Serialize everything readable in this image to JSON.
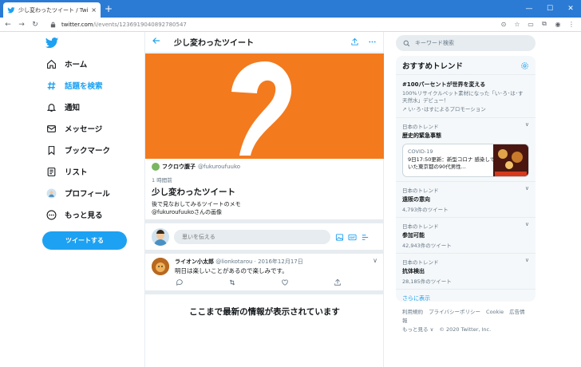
{
  "browser": {
    "tab_title": "少し変わったツイート / Twitter",
    "tab_close": "×",
    "new_tab": "+",
    "url_host": "twitter.com",
    "url_path": "/i/events/1236919040892780547",
    "window_buttons": [
      "—",
      "☐",
      "✕"
    ]
  },
  "nav": {
    "items": [
      {
        "label": "ホーム",
        "icon": "home-icon"
      },
      {
        "label": "話題を検索",
        "icon": "hashtag-icon",
        "active": true
      },
      {
        "label": "通知",
        "icon": "bell-icon"
      },
      {
        "label": "メッセージ",
        "icon": "mail-icon"
      },
      {
        "label": "ブックマーク",
        "icon": "bookmark-icon"
      },
      {
        "label": "リスト",
        "icon": "list-icon"
      },
      {
        "label": "プロフィール",
        "icon": "profile-avatar"
      },
      {
        "label": "もっと見る",
        "icon": "more-icon"
      }
    ],
    "tweet_button": "ツイートする"
  },
  "center": {
    "header_title": "少し変わったツイート",
    "owner_name": "フクロウ腹子",
    "owner_handle": "@fukuroufuuko",
    "time": "1 時間前",
    "title": "少し変わったツイート",
    "description_line1": "後で見なおしてみるツイートのメモ",
    "description_line2": "@fukuroufuukoさんの画像",
    "compose_placeholder": "思いを伝える",
    "tweet": {
      "name": "ライオン小太郎",
      "handle": "@lionkotarou",
      "date": "· 2016年12月17日",
      "text": "明日は楽しいことがあるので楽しみです。"
    },
    "end_message": "ここまで最新の情報が表示されています"
  },
  "right": {
    "search_placeholder": "キーワード検索",
    "trends_title": "おすすめトレンド",
    "promo": {
      "title": "#100パーセントが世界を変える",
      "desc": "100%リサイクルペット素材になった「い･ろ･は･す 天然水」デビュー！",
      "promoted": "い･ろ･はすによるプロモーション"
    },
    "trend1": {
      "category": "日本のトレンド",
      "name": "歴史的緊急事態",
      "news_label": "COVID-19",
      "news_text": "9日17:50更新：新型コロナ 感染していた東京都の90代男性..."
    },
    "trend2": {
      "category": "日本のトレンド",
      "name": "遠阪の意向",
      "count": "4,793件のツイート"
    },
    "trend3": {
      "category": "日本のトレンド",
      "name": "参加可能",
      "count": "42,943件のツイート"
    },
    "trend4": {
      "category": "日本のトレンド",
      "name": "抗体検出",
      "count": "28,185件のツイート"
    },
    "show_more": "さらに表示",
    "footer": [
      "利用規約",
      "プライバシーポリシー",
      "Cookie",
      "広告情報",
      "もっと見る ∨",
      "© 2020 Twitter, Inc."
    ]
  },
  "colors": {
    "accent": "#1da1f2",
    "banner": "#f47a1e",
    "chrome": "#2b7bd4"
  }
}
